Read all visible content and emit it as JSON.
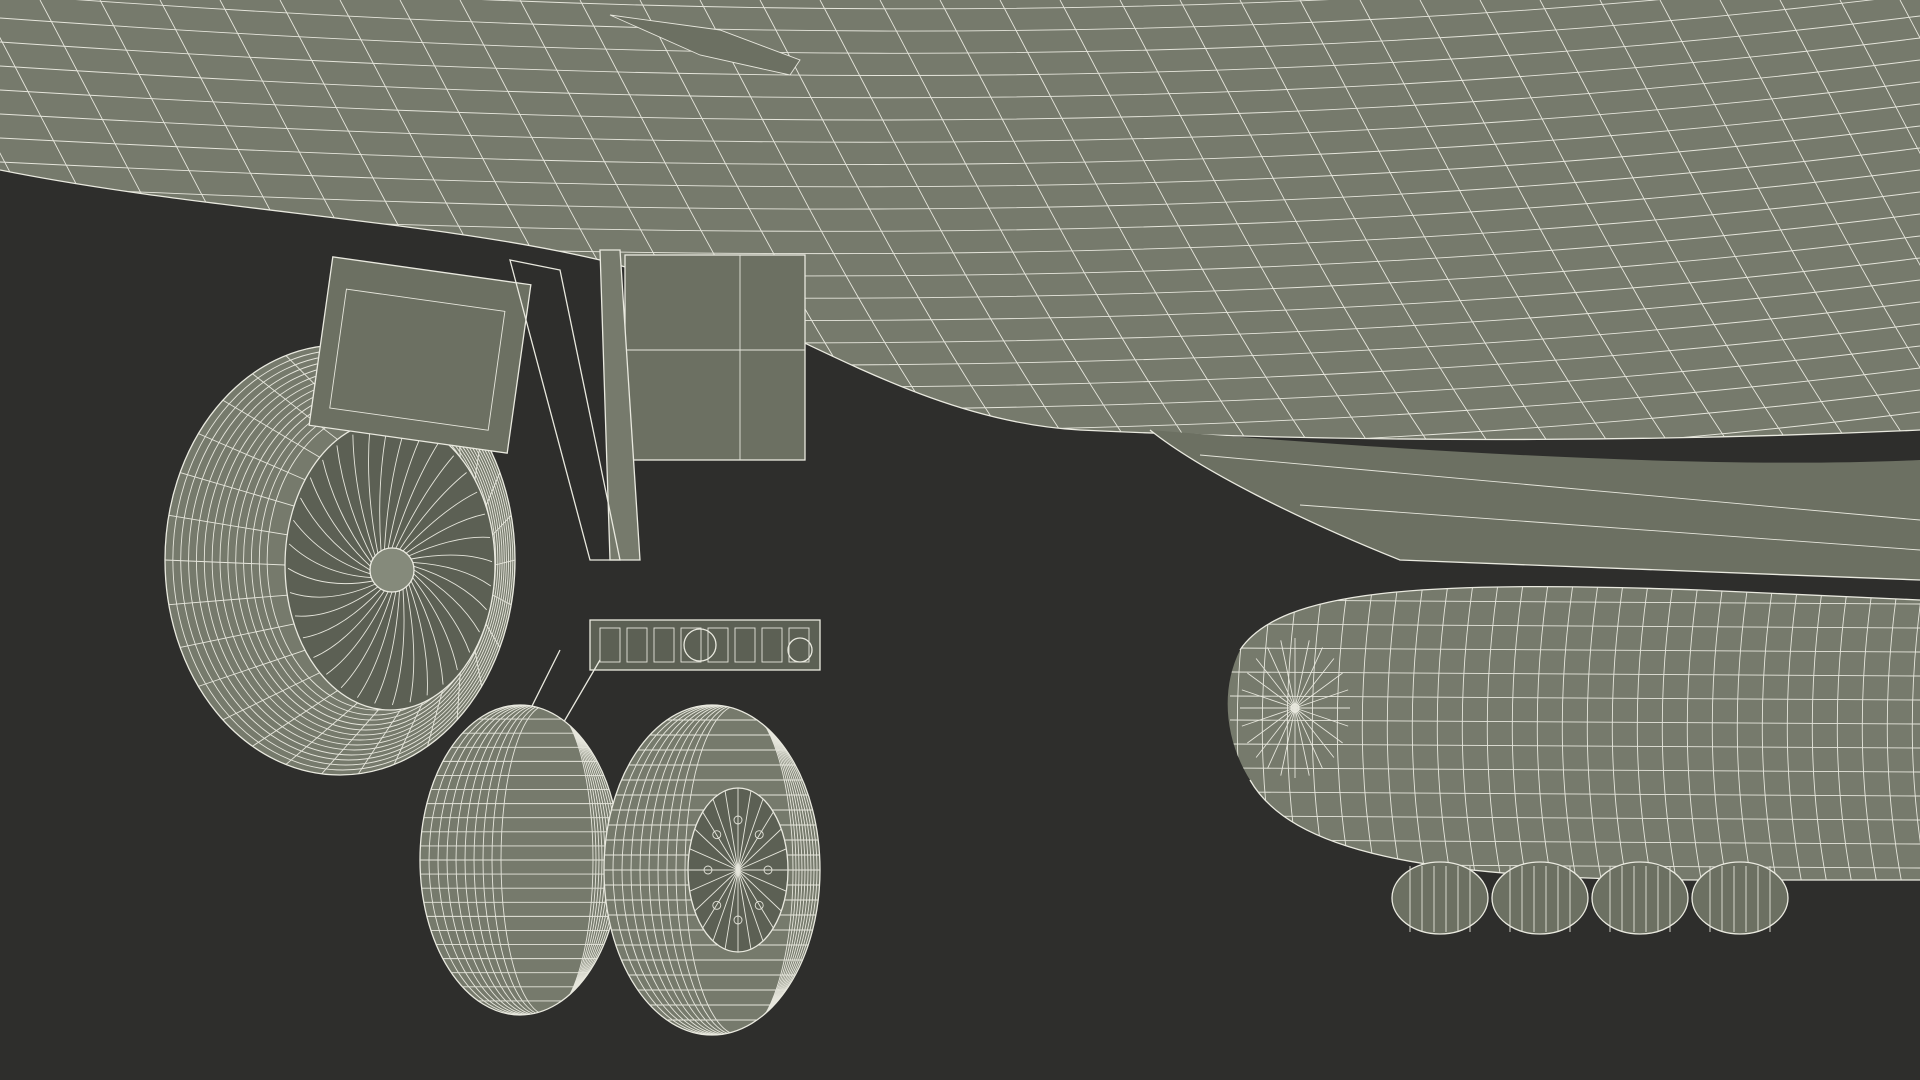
{
  "scene": {
    "subject": "",
    "background_color": "#2e2e2c",
    "surface_color": "#767a6c",
    "wire_color": "#e9e9df"
  }
}
